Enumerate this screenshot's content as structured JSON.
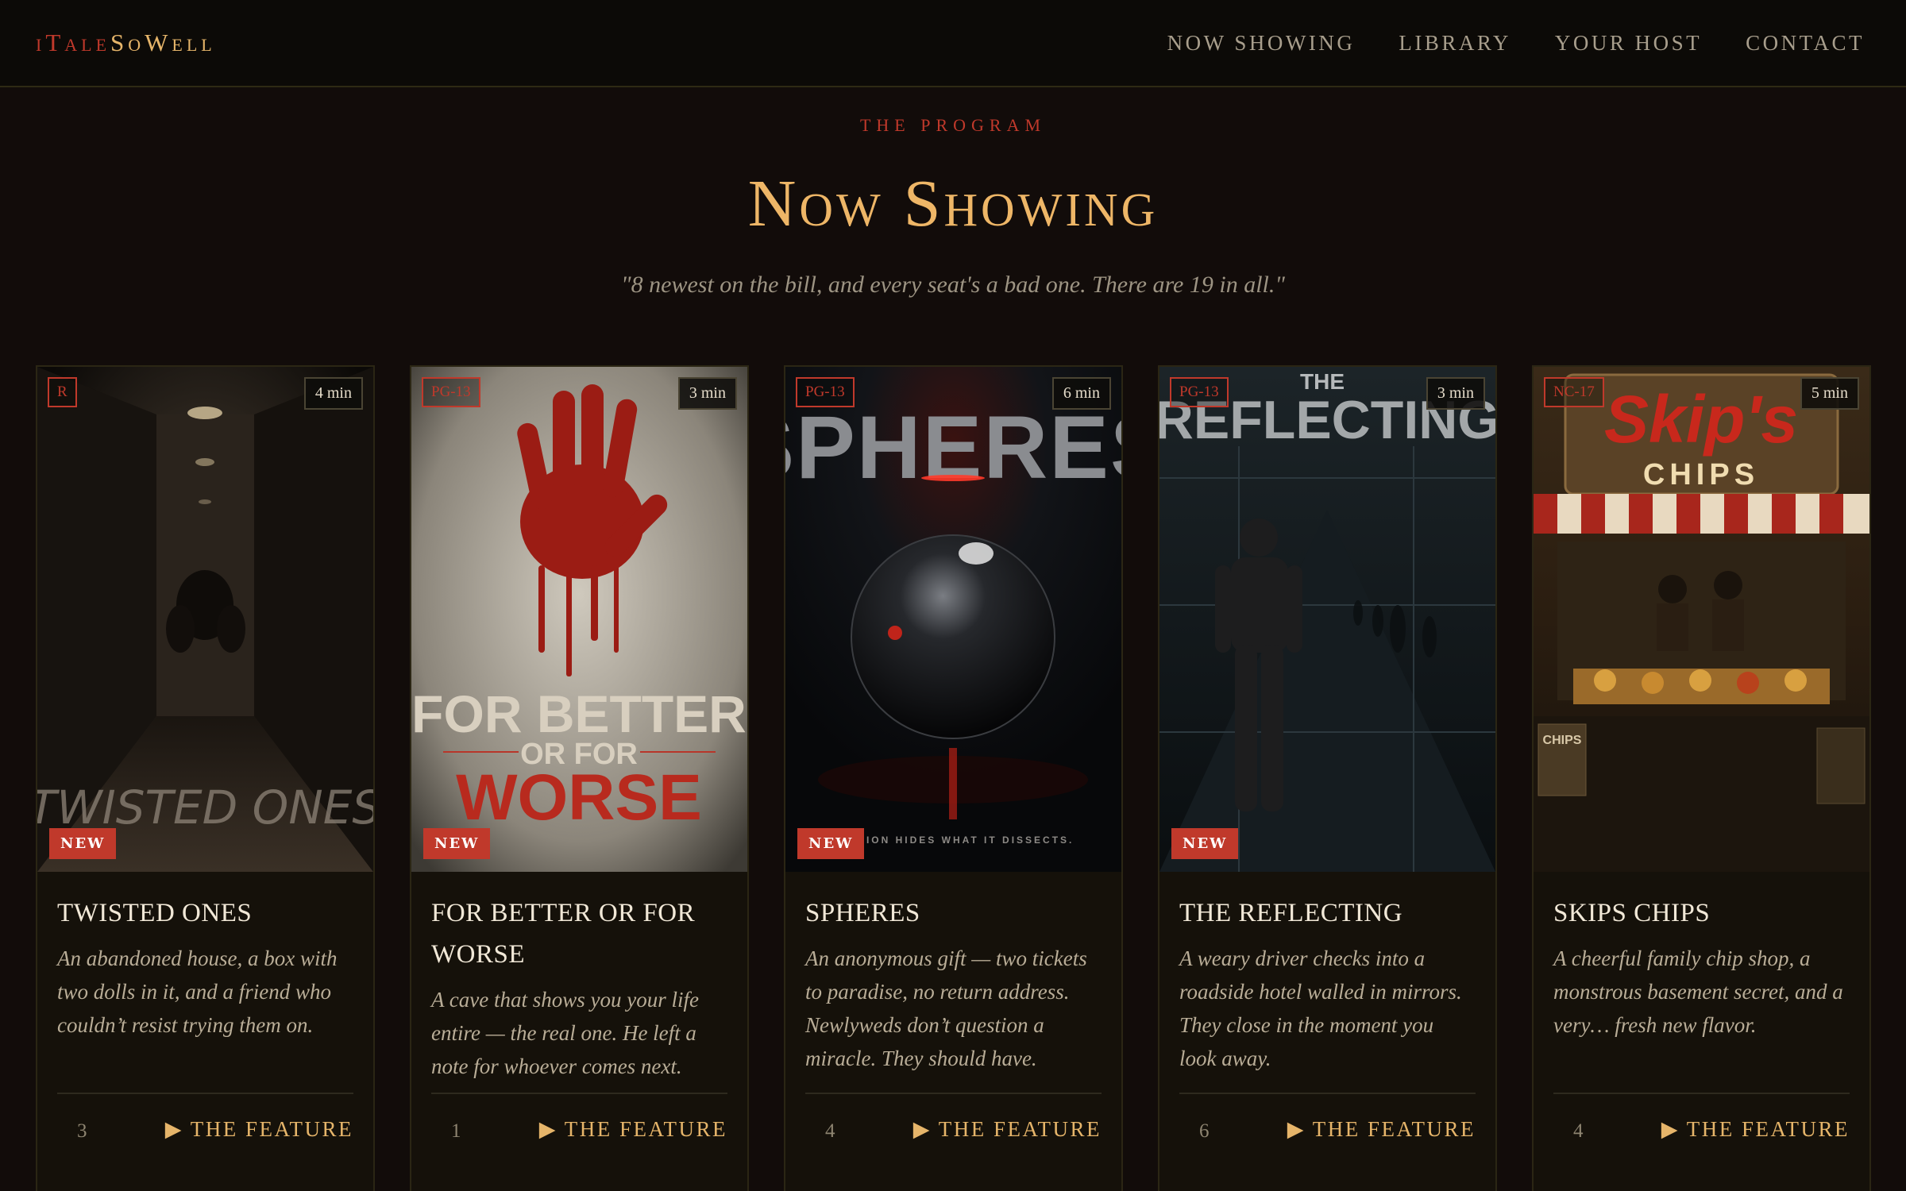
{
  "brand": {
    "logo_a": "i",
    "logo_b": "Tale",
    "logo_c": "So",
    "logo_d": "Well"
  },
  "nav": [
    "NOW SHOWING",
    "LIBRARY",
    "YOUR HOST",
    "CONTACT"
  ],
  "section": {
    "eyebrow": "THE PROGRAM",
    "title": "Now Showing",
    "subtitle": "\"8 newest on the bill, and every seat's a bad one. There are 19 in all.\""
  },
  "cards": [
    {
      "rating": "R",
      "duration": "4 min",
      "badge": "NEW",
      "title": "TWISTED ONES",
      "description": "An abandoned house, a box with two dolls in it, and a friend who couldn’t resist trying them on.",
      "count": "3",
      "cta": "▶ THE FEATURE",
      "poster_text": "TWISTED ONES"
    },
    {
      "rating": "PG-13",
      "duration": "3 min",
      "badge": "NEW",
      "title": "FOR BETTER OR FOR WORSE",
      "description": "A cave that shows you your life entire — the real one. He left a note for whoever comes next.",
      "count": "1",
      "cta": "▶ THE FEATURE",
      "poster_line1": "FOR BETTER",
      "poster_line2": "OR FOR",
      "poster_line3": "WORSE"
    },
    {
      "rating": "PG-13",
      "duration": "6 min",
      "badge": "NEW",
      "title": "SPHERES",
      "description": "An anonymous gift — two tickets to paradise, no return address. Newlyweds don’t question a miracle. They should have.",
      "count": "4",
      "cta": "▶ THE FEATURE",
      "poster_text": "SPHERES",
      "poster_tagline": "FECTION HIDES WHAT IT DISSECTS."
    },
    {
      "rating": "PG-13",
      "duration": "3 min",
      "badge": "NEW",
      "title": "THE REFLECTING",
      "description": "A weary driver checks into a roadside hotel walled in mirrors. They close in the moment you look away.",
      "count": "6",
      "cta": "▶ THE FEATURE",
      "poster_line1": "THE",
      "poster_line2": "REFLECTING"
    },
    {
      "rating": "NC-17",
      "duration": "5 min",
      "title": "SKIPS CHIPS",
      "description": "A cheerful family chip shop, a monstrous basement secret, and a very… fresh new flavor.",
      "count": "4",
      "cta": "▶ THE FEATURE",
      "poster_line1": "Skip's",
      "poster_line2": "CHIPS",
      "poster_side": "CHIPS"
    }
  ],
  "colors": {
    "accent_red": "#c0392b",
    "accent_gold": "#eeb667",
    "background": "#120c0a"
  }
}
